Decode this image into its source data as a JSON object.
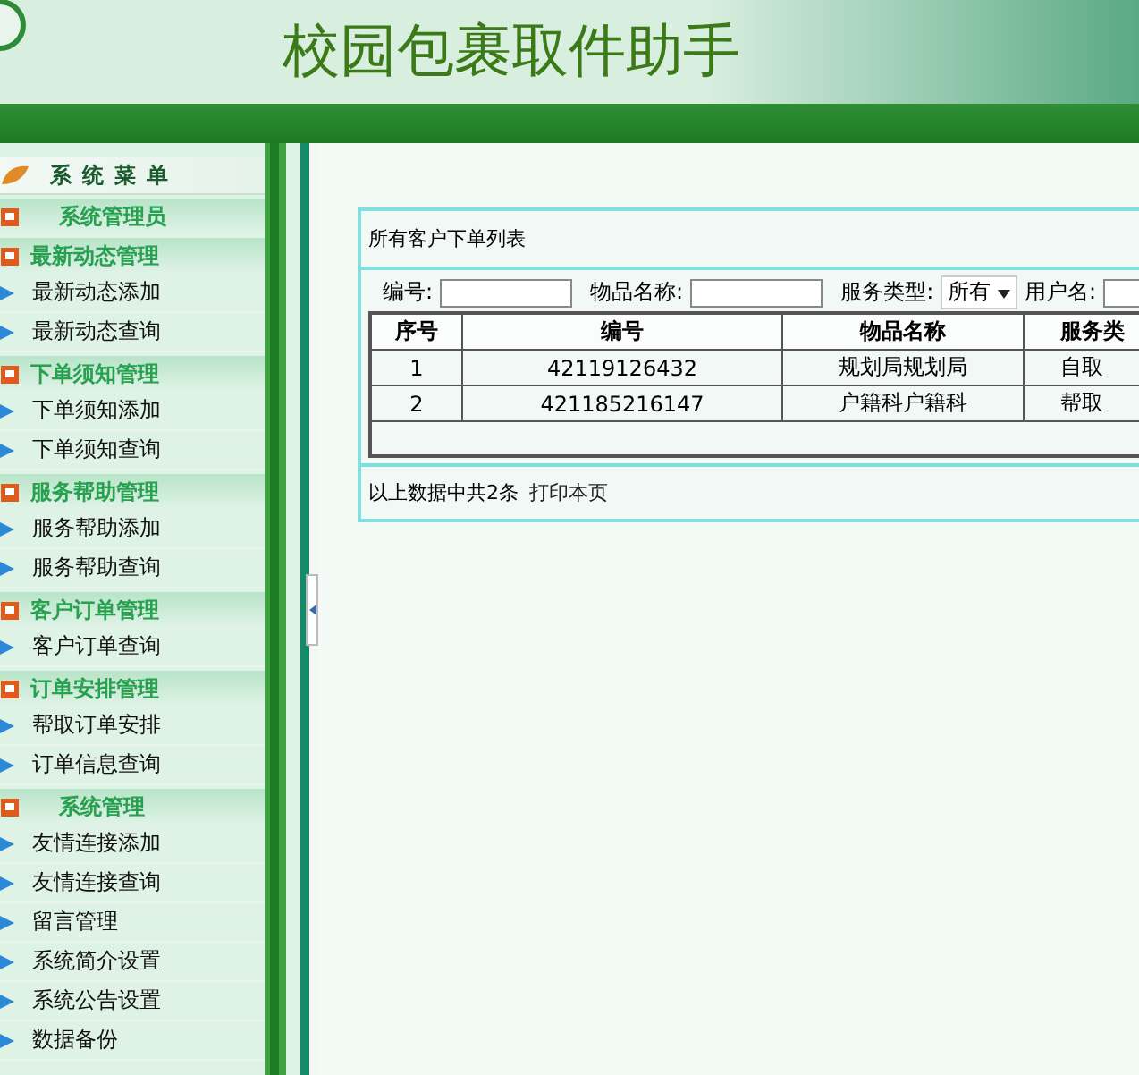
{
  "header": {
    "title": "校园包裹取件助手"
  },
  "sidebar": {
    "title": "系统菜单",
    "groups": [
      {
        "label": "系统管理员"
      },
      {
        "label": "最新动态管理",
        "items": [
          "最新动态添加",
          "最新动态查询"
        ]
      },
      {
        "label": "下单须知管理",
        "items": [
          "下单须知添加",
          "下单须知查询"
        ]
      },
      {
        "label": "服务帮助管理",
        "items": [
          "服务帮助添加",
          "服务帮助查询"
        ]
      },
      {
        "label": "客户订单管理",
        "items": [
          "客户订单查询"
        ]
      },
      {
        "label": "订单安排管理",
        "items": [
          "帮取订单安排",
          "订单信息查询"
        ]
      },
      {
        "label": "系统管理",
        "items": [
          "友情连接添加",
          "友情连接查询",
          "留言管理",
          "系统简介设置",
          "系统公告设置",
          "数据备份"
        ]
      }
    ]
  },
  "panel": {
    "title": "所有客户下单列表",
    "filters": [
      {
        "label": "编号:",
        "kind": "input"
      },
      {
        "label": "物品名称:",
        "kind": "input"
      },
      {
        "label": "服务类型:",
        "kind": "select",
        "value": "所有"
      },
      {
        "label": "用户名:",
        "kind": "input"
      }
    ],
    "table": {
      "columns": [
        "序号",
        "编号",
        "物品名称",
        "服务类"
      ],
      "rows": [
        [
          "1",
          "42119126432",
          "规划局规划局",
          "自取"
        ],
        [
          "2",
          "421185216147",
          "户籍科户籍科",
          "帮取"
        ]
      ]
    },
    "summary": "以上数据中共2条",
    "print_link": "打印本页"
  }
}
